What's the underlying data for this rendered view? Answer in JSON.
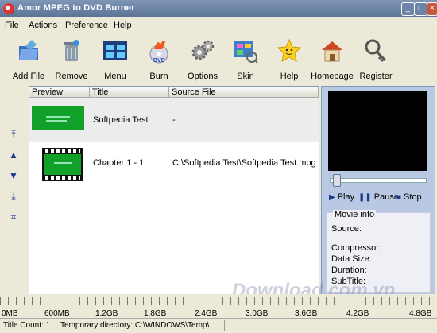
{
  "window": {
    "title": "Amor MPEG to DVD Burner"
  },
  "menu": [
    "File",
    "Actions",
    "Preference",
    "Help"
  ],
  "toolbar": [
    {
      "label": "Add File",
      "icon": "add-file-icon"
    },
    {
      "label": "Remove",
      "icon": "remove-icon"
    },
    {
      "label": "Menu",
      "icon": "menu-icon"
    },
    {
      "label": "Burn",
      "icon": "burn-icon"
    },
    {
      "label": "Options",
      "icon": "options-icon"
    },
    {
      "label": "Skin",
      "icon": "skin-icon"
    },
    {
      "label": "Help",
      "icon": "help-icon"
    },
    {
      "label": "Homepage",
      "icon": "homepage-icon"
    },
    {
      "label": "Register",
      "icon": "register-icon"
    }
  ],
  "list": {
    "columns": [
      "Preview",
      "Title",
      "Source File"
    ],
    "rows": [
      {
        "title": "Softpedia Test",
        "source": "-"
      },
      {
        "title": "Chapter 1 - 1",
        "source": "C:\\Softpedia Test\\Softpedia Test.mpg"
      }
    ]
  },
  "player": {
    "play": "Play",
    "pause": "Pause",
    "stop": "Stop"
  },
  "movie_info": {
    "legend": "Movie info",
    "source": "Source:",
    "compressor": "Compressor:",
    "data_size": "Data Size:",
    "duration": "Duration:",
    "subtitle": "SubTitle:"
  },
  "scale": [
    "0MB",
    "600MB",
    "1.2GB",
    "1.8GB",
    "2.4GB",
    "3.0GB",
    "3.6GB",
    "4.2GB",
    "4.8GB"
  ],
  "status": {
    "title_count": "Title Count: 1",
    "temp_dir": "Temporary directory: C:\\WINDOWS\\Temp\\"
  },
  "watermark": "Download.com.vn"
}
